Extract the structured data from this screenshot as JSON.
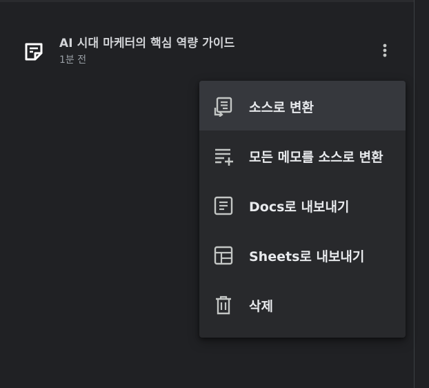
{
  "note": {
    "title": "AI 시대 마케터의 핵심 역량 가이드",
    "timestamp": "1분 전",
    "icon": "note-icon",
    "more_icon": "more-vert-icon"
  },
  "menu": {
    "items": [
      {
        "label": "소스로 변환",
        "icon": "convert-to-source-icon",
        "active": true
      },
      {
        "label": "모든 메모를 소스로 변환",
        "icon": "playlist-add-icon",
        "active": false
      },
      {
        "label": "Docs로 내보내기",
        "icon": "docs-icon",
        "active": false
      },
      {
        "label": "Sheets로 내보내기",
        "icon": "sheets-icon",
        "active": false
      },
      {
        "label": "삭제",
        "icon": "trash-icon",
        "active": false
      }
    ]
  },
  "colors": {
    "background": "#202124",
    "menu_background": "#28292c",
    "menu_active": "#36383d",
    "text_primary": "#e8eaed",
    "text_secondary": "#9aa0a6"
  }
}
